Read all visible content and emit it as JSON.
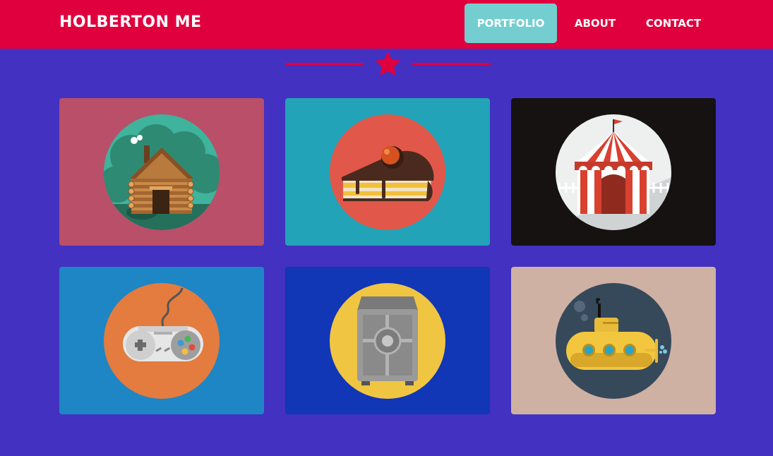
{
  "header": {
    "brand": "HOLBERTON ME",
    "nav": [
      {
        "label": "PORTFOLIO",
        "active": true
      },
      {
        "label": "ABOUT",
        "active": false
      },
      {
        "label": "CONTACT",
        "active": false
      }
    ]
  },
  "divider": {
    "icon": "star-icon",
    "color": "#e0003d"
  },
  "colors": {
    "header_bg": "#e0003d",
    "page_bg": "#4331c1",
    "active_nav_bg": "#74ced0"
  },
  "portfolio": {
    "tiles": [
      {
        "icon": "log-cabin-icon",
        "bg": "#b94f68",
        "circle": "#3fb39b"
      },
      {
        "icon": "cake-slice-icon",
        "bg": "#22a3b8",
        "circle": "#e1584a"
      },
      {
        "icon": "circus-tent-icon",
        "bg": "#161212",
        "circle": "#eef0f0"
      },
      {
        "icon": "game-controller-icon",
        "bg": "#1e86c4",
        "circle": "#e37c3e"
      },
      {
        "icon": "safe-icon",
        "bg": "#1136b6",
        "circle": "#f0c542"
      },
      {
        "icon": "submarine-icon",
        "bg": "#cfb1a4",
        "circle": "#35495a"
      }
    ]
  }
}
